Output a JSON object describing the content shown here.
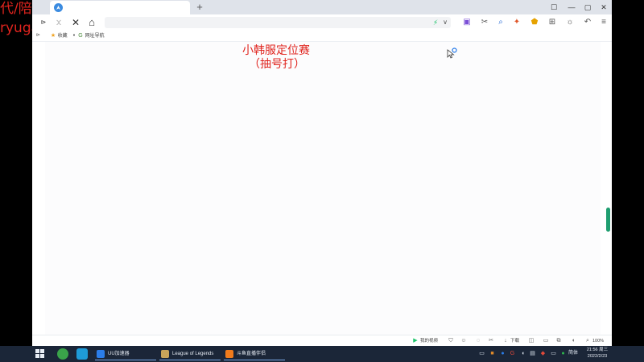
{
  "overlay": {
    "line1": "代/陪玩",
    "line2": "ryuga-"
  },
  "browser": {
    "new_tab_glyph": "+",
    "window_controls": [
      "☐",
      "—",
      "▢",
      "✕"
    ],
    "nav": {
      "expand": "⊳",
      "back": "‹",
      "forward": "›",
      "stop": "✕",
      "home": "⌂"
    },
    "addressbar": {
      "value": "",
      "flash_glyph": "⚡",
      "dropdown_glyph": "∨"
    },
    "bookmarks": {
      "toggle": "⊳",
      "items": [
        {
          "icon": "star-icon",
          "label": "收藏"
        },
        {
          "icon": "dot-icon",
          "label": ""
        },
        {
          "icon": "g-icon",
          "label": "网址导航"
        }
      ]
    },
    "content": {
      "promo_line1": "小韩服定位赛",
      "promo_line2": "（抽号打）"
    },
    "statusbar": {
      "video_label": "我的视频",
      "download_label": "下载",
      "zoom_label": "100%"
    }
  },
  "taskbar": {
    "apps": [
      {
        "label": "UU加速器",
        "icon_color": "#2b7de9"
      },
      {
        "label": "League of Legends",
        "icon_color": "#c8a45a"
      },
      {
        "label": "斗鱼直播伴侣",
        "icon_color": "#f07b1c"
      }
    ],
    "ime_label": "简体",
    "time": "21:56 周三",
    "date": "2022/2/23"
  },
  "colors": {
    "overlay_red": "#e0241e",
    "taskbar_bg": "#1b2638",
    "scroll_thumb": "#1f9e70"
  }
}
